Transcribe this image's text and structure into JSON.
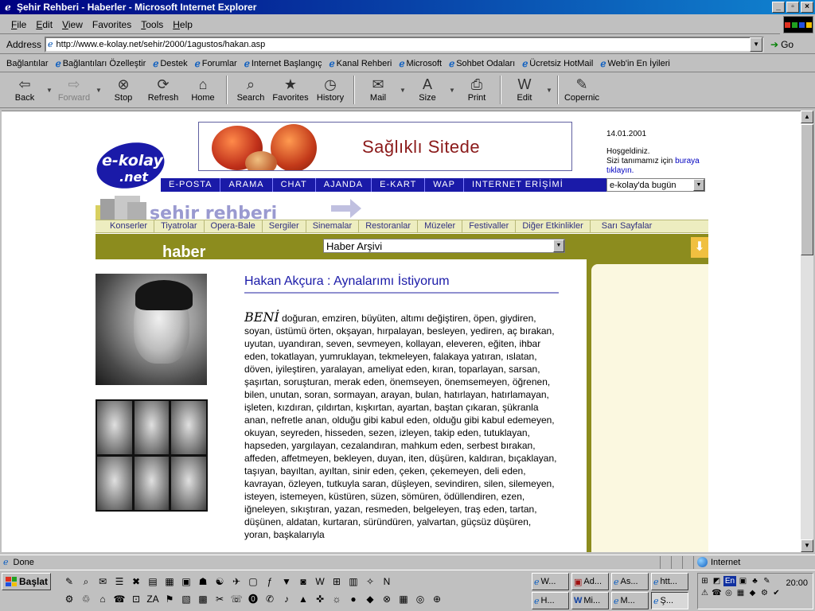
{
  "window": {
    "title": "Şehir Rehberi - Haberler - Microsoft Internet Explorer",
    "buttons": [
      "_",
      "▫",
      "×"
    ]
  },
  "menu": {
    "items": [
      {
        "key": "F",
        "rest": "ile"
      },
      {
        "key": "E",
        "rest": "dit"
      },
      {
        "key": "V",
        "rest": "iew"
      },
      {
        "key": "",
        "rest": "Favorites"
      },
      {
        "key": "T",
        "rest": "ools"
      },
      {
        "key": "H",
        "rest": "elp"
      }
    ]
  },
  "address": {
    "label": "Address",
    "url": "http://www.e-kolay.net/sehir/2000/1agustos/hakan.asp",
    "go": "Go"
  },
  "links": {
    "first": "Bağlantılar",
    "items": [
      "Bağlantıları Özelleştir",
      "Destek",
      "Forumlar",
      "Internet Başlangıç",
      "Kanal Rehberi",
      "Microsoft",
      "Sohbet Odaları",
      "Ücretsiz HotMail",
      "Web'in En İyileri"
    ]
  },
  "toolbar": {
    "buttons": [
      {
        "label": "Back",
        "icon": "back-arrow-icon",
        "glyph": "⇦",
        "enabled": true,
        "drop": true
      },
      {
        "label": "Forward",
        "icon": "forward-arrow-icon",
        "glyph": "⇨",
        "enabled": false,
        "drop": true
      },
      {
        "label": "Stop",
        "icon": "stop-icon",
        "glyph": "⊗",
        "enabled": true,
        "drop": false
      },
      {
        "label": "Refresh",
        "icon": "refresh-icon",
        "glyph": "⟳",
        "enabled": true,
        "drop": false
      },
      {
        "label": "Home",
        "icon": "home-icon",
        "glyph": "⌂",
        "enabled": true,
        "drop": false
      },
      {
        "label": "Search",
        "icon": "search-icon",
        "glyph": "⌕",
        "enabled": true,
        "drop": false
      },
      {
        "label": "Favorites",
        "icon": "favorites-icon",
        "glyph": "★",
        "enabled": true,
        "drop": false
      },
      {
        "label": "History",
        "icon": "history-icon",
        "glyph": "◷",
        "enabled": true,
        "drop": false
      },
      {
        "label": "Mail",
        "icon": "mail-icon",
        "glyph": "✉",
        "enabled": true,
        "drop": true
      },
      {
        "label": "Size",
        "icon": "font-size-icon",
        "glyph": "A",
        "enabled": true,
        "drop": true
      },
      {
        "label": "Print",
        "icon": "print-icon",
        "glyph": "⎙",
        "enabled": true,
        "drop": false
      },
      {
        "label": "Edit",
        "icon": "edit-icon",
        "glyph": "W",
        "enabled": true,
        "drop": true
      },
      {
        "label": "Copernic",
        "icon": "copernic-icon",
        "glyph": "✎",
        "enabled": true,
        "drop": false
      }
    ]
  },
  "page": {
    "logo_line1": "e-kolay",
    "logo_line2": ".net",
    "banner_text": "Sağlıklı Sitede",
    "date": "14.01.2001",
    "welcome": "Hoşgeldiniz.",
    "intro": "Sizi tanımamız için",
    "link1": "buraya",
    "link2": "tıklayın.",
    "nav": [
      "E-POSTA",
      "ARAMA",
      "CHAT",
      "AJANDA",
      "E-KART",
      "WAP",
      "INTERNET ERİŞİMİ"
    ],
    "today_select": "e-kolay'da bugün",
    "section_title": "şehir rehberi",
    "categories": [
      "Konserler",
      "Tiyatrolar",
      "Opera-Bale",
      "Sergiler",
      "Sinemalar",
      "Restoranlar",
      "Müzeler",
      "Festivaller",
      "Diğer Etkinlikler",
      "Sarı Sayfalar"
    ],
    "haber_label": "haber",
    "archive_select": "Haber Arşivi",
    "article_title": "Hakan Akçura : Aynalarımı İstiyorum",
    "drop_word": "BENİ",
    "article_body": " doğuran, emziren, büyüten, altımı değiştiren, öpen, giydiren, soyan, üstümü örten, okşayan, hırpalayan, besleyen, yediren, aç bırakan, uyutan, uyandıran, seven, sevmeyen, kollayan, eleveren, eğiten, ihbar eden, tokatlayan, yumruklayan, tekmeleyen, falakaya yatıran, ıslatan, döven, iyileştiren, yaralayan, ameliyat eden, kıran, toparlayan, sarsan, şaşırtan, soruşturan, merak eden, önemseyen, önemsemeyen, öğrenen, bilen, unutan, soran, sormayan, arayan, bulan, hatırlayan, hatırlamayan, işleten, kızdıran, çıldırtan, kışkırtan, ayartan, baştan çıkaran, şükranla anan, nefretle anan, olduğu gibi kabul eden, olduğu gibi kabul edemeyen, okuyan, seyreden, hisseden, sezen, izleyen, takip eden, tutuklayan, hapseden, yargılayan, cezalandıran, mahkum eden, serbest bırakan, affeden, affetmeyen, bekleyen, duyan, iten, düşüren, kaldıran, bıçaklayan, taşıyan, bayıltan, ayıltan, sinir eden, çeken, çekemeyen, deli eden, kavrayan, özleyen, tutkuyla saran, düşleyen, sevindiren, silen, silemeyen, isteyen, istemeyen, küstüren, süzen, sömüren, ödüllendiren, ezen, iğneleyen, sıkıştıran, yazan, resmeden, belgeleyen, traş eden, tartan, düşünen, aldatan, kurtaran, süründüren, yalvartan, güçsüz düşüren, yoran, başkalarıyla"
  },
  "status": {
    "text": "Done",
    "zone": "Internet"
  },
  "taskbar": {
    "start": "Başlat",
    "tasks": [
      "W...",
      "Ad...",
      "As...",
      "htt...",
      "H...",
      "Mi...",
      "M...",
      "Ş..."
    ],
    "clock": "20:00",
    "lang": "En"
  }
}
